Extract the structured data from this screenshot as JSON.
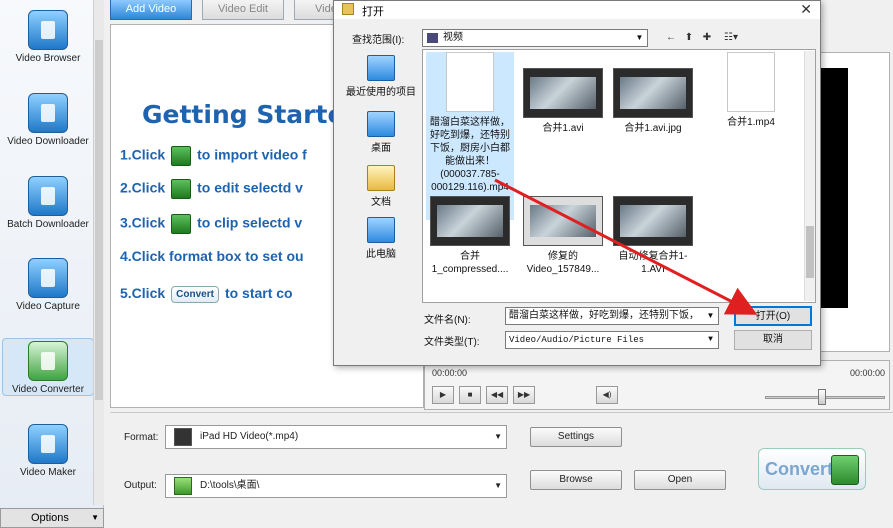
{
  "tabs": [
    "Add Video",
    "Video Edit",
    "Vide"
  ],
  "sidebar": {
    "items": [
      {
        "label": "Video Browser",
        "icon": "video-browser-icon"
      },
      {
        "label": "Video Downloader",
        "icon": "video-downloader-icon"
      },
      {
        "label": "Batch Downloader",
        "icon": "batch-downloader-icon"
      },
      {
        "label": "Video Capture",
        "icon": "video-capture-icon"
      },
      {
        "label": "Video Converter",
        "icon": "video-converter-icon"
      },
      {
        "label": "Video Maker",
        "icon": "video-maker-icon"
      }
    ],
    "options_label": "Options"
  },
  "getting_started": {
    "title": "Getting Starte",
    "steps": [
      {
        "pre": "1.Click",
        "post": "to import video f"
      },
      {
        "pre": "2.Click",
        "post": "to edit selectd v"
      },
      {
        "pre": "3.Click",
        "post": "to clip selectd v"
      },
      {
        "pre": "4.Click format box to set ou",
        "post": ""
      },
      {
        "pre": "5.Click",
        "post": "to start co",
        "button": "Convert"
      }
    ]
  },
  "player": {
    "time_left": "00:00:00",
    "time_right": "00:00:00"
  },
  "bottom": {
    "format_label": "Format:",
    "format_value": "iPad HD Video(*.mp4)",
    "output_label": "Output:",
    "output_value": "D:\\tools\\桌面\\",
    "settings_label": "Settings",
    "browse_label": "Browse",
    "open_label": "Open",
    "convert_label": "Convert"
  },
  "dialog": {
    "title": "打开",
    "look_in_label": "查找范围(I):",
    "look_in_value": "视频",
    "places": [
      "最近使用的项目",
      "桌面",
      "文档",
      "此电脑"
    ],
    "files": [
      {
        "name": "醋溜白菜这样做，好吃到爆，还特别下饭，厨房小白都能做出来！(000037.785-000129.116).mp4",
        "kind": "doc",
        "selected": true
      },
      {
        "name": "合并1.avi",
        "kind": "video"
      },
      {
        "name": "合并1.avi.jpg",
        "kind": "video"
      },
      {
        "name": "合并1.mp4",
        "kind": "doc"
      },
      {
        "name": "合并1_compressed....",
        "kind": "video"
      },
      {
        "name": "修复的Video_157849...",
        "kind": "video"
      },
      {
        "name": "自动修复合并1-1.AVI",
        "kind": "video"
      }
    ],
    "filename_label": "文件名(N):",
    "filename_value": "醋溜白菜这样做，好吃到爆，还特别下饭，",
    "filetype_label": "文件类型(T):",
    "filetype_value": "Video/Audio/Picture Files",
    "open_button": "打开(O)",
    "cancel_button": "取消",
    "close_symbol": "✕"
  },
  "colors": {
    "accent": "#1e63b0",
    "annotation_arrow": "#e02020",
    "tab_active": "#2e86d6"
  }
}
